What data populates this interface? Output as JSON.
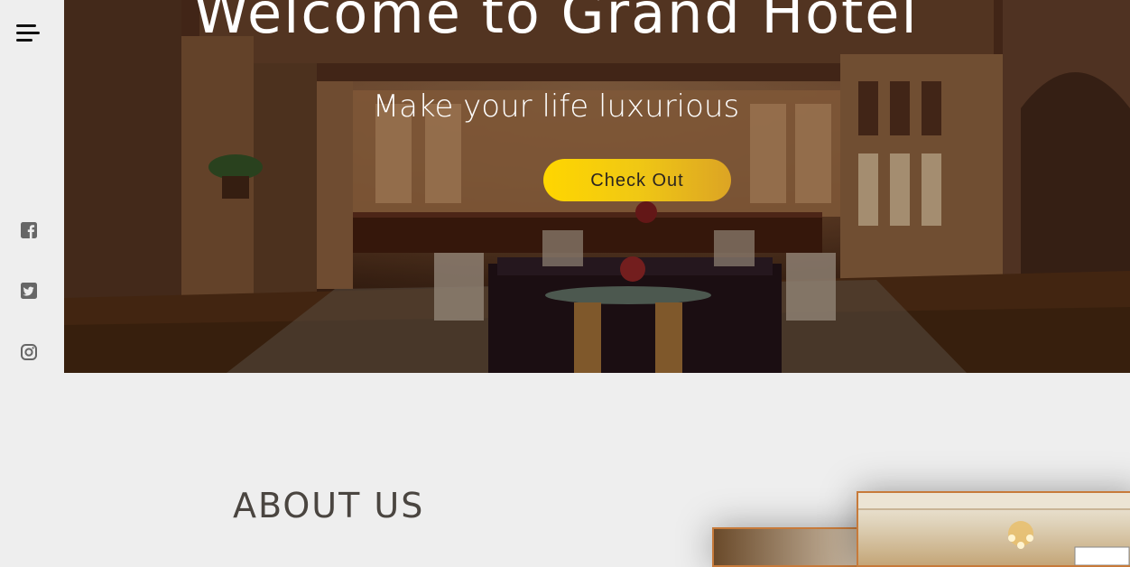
{
  "nav": {
    "menu_icon": "hamburger-menu-icon",
    "social": [
      {
        "name": "facebook",
        "icon": "facebook-icon"
      },
      {
        "name": "twitter",
        "icon": "twitter-icon"
      },
      {
        "name": "instagram",
        "icon": "instagram-icon"
      }
    ]
  },
  "hero": {
    "title": "Welcome to Grand Hotel",
    "subtitle": "Make your life luxurious",
    "cta_label": "Check Out"
  },
  "about": {
    "title": "ABOUT US"
  },
  "colors": {
    "background": "#eeeeee",
    "cta_gradient_start": "#ffd600",
    "cta_gradient_end": "#dca424",
    "photo_border": "#c77a3a",
    "heading": "#4a4540"
  }
}
